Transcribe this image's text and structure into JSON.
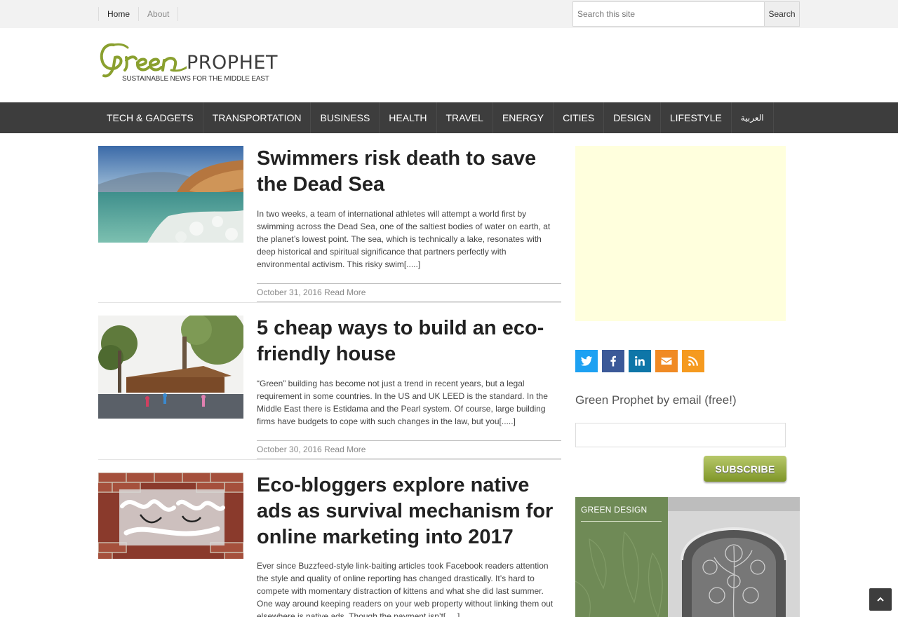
{
  "topbar": {
    "links": [
      {
        "label": "Home",
        "active": true
      },
      {
        "label": "About",
        "active": false
      }
    ],
    "search": {
      "placeholder": "Search this site",
      "button": "Search"
    }
  },
  "logo": {
    "wordmark": "PROPHET",
    "script_text": "Green",
    "tagline": "SUSTAINABLE NEWS FOR THE MIDDLE EAST"
  },
  "nav": {
    "items": [
      "TECH & GADGETS",
      "TRANSPORTATION",
      "BUSINESS",
      "HEALTH",
      "TRAVEL",
      "ENERGY",
      "CITIES",
      "DESIGN",
      "LIFESTYLE",
      "العربية"
    ]
  },
  "articles": [
    {
      "title": "Swimmers risk death to save the Dead Sea",
      "excerpt": "In two weeks, a team of international athletes will attempt a world first by swimming across the Dead Sea, one of the saltiest bodies of water on earth, at the planet’s lowest point. The sea, which is technically a lake, resonates with deep historical and spiritual significance that partners perfectly with environmental activism. This risky swim[.....]",
      "date": "October 31, 2016",
      "read_more": "Read More",
      "image": "dead-sea-photo"
    },
    {
      "title": "5 cheap ways to build an eco-friendly house",
      "excerpt": "“Green” building has become not just a trend in recent years, but a legal requirement in some countries. In the US and UK LEED is the standard. In the Middle East there is Estidama and the Pearl system. Of course, large building firms have budgets to cope with such changes in the law, but you[.....]",
      "date": "October 30, 2016",
      "read_more": "Read More",
      "image": "playground-pavilion-photo"
    },
    {
      "title": "Eco-bloggers explore native ads as survival mechanism for online marketing into 2017",
      "excerpt": "Ever since Buzzfeed-style link-baiting articles took Facebook readers attention the style and quality of online reporting has changed drastically.  It’s hard to compete with momentary distraction of kittens and what she did last summer. One way around keeping readers on your web property without linking them out elsewhere is native ads. Though the payment isn’t[.....]",
      "image": "graffiti-brick-wall-photo"
    }
  ],
  "sidebar": {
    "social": [
      {
        "icon": "twitter-icon",
        "color": "#1da1f2"
      },
      {
        "icon": "facebook-icon",
        "color": "#3b5998"
      },
      {
        "icon": "linkedin-icon",
        "color": "#0e76a8"
      },
      {
        "icon": "email-icon",
        "color": "#f08a24"
      },
      {
        "icon": "rss-icon",
        "color": "#f59a1f"
      }
    ],
    "email_heading": "Green Prophet by email (free!)",
    "email_value": "",
    "subscribe_label": "SUBSCRIBE",
    "promo_title": "GREEN DESIGN"
  },
  "colors": {
    "nav_bg": "#3d3d3d",
    "brand_green": "#8aa02f",
    "ad_bg": "#ffffdd"
  }
}
